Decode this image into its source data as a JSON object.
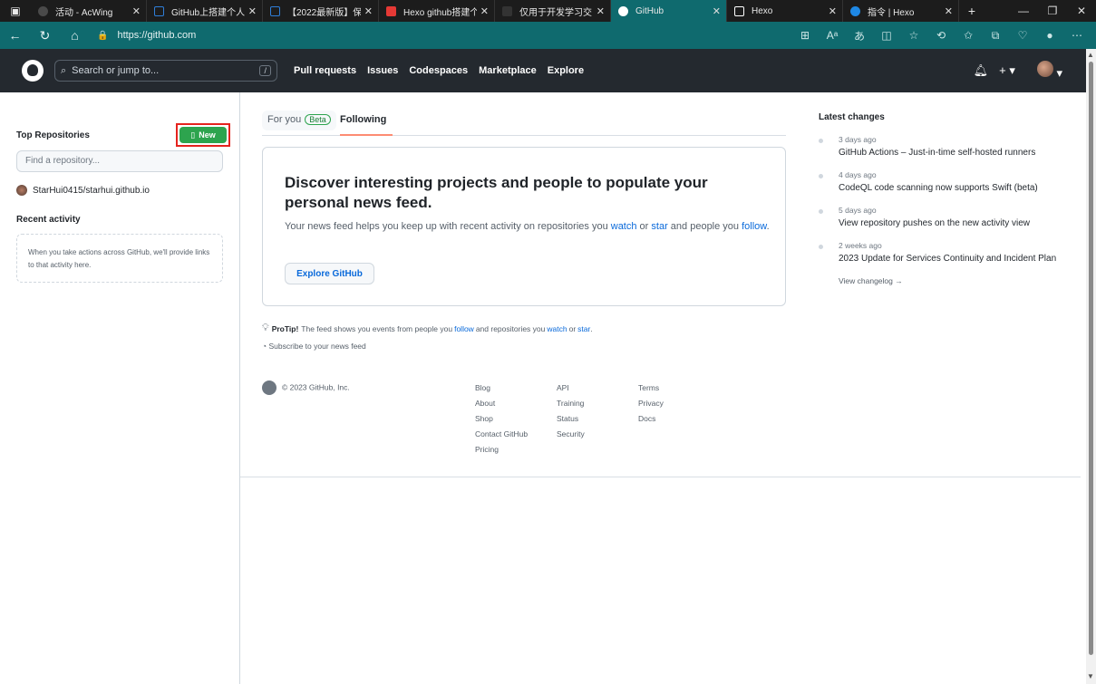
{
  "browser": {
    "tabs": [
      {
        "label": "活动 - AcWing",
        "color": "#4a4a4a"
      },
      {
        "label": "GitHub上搭建个人",
        "color": "#2f7ed8"
      },
      {
        "label": "【2022最新版】保",
        "color": "#2f7ed8"
      },
      {
        "label": "Hexo github搭建个",
        "color": "#e53935"
      },
      {
        "label": "仅用于开发学习交",
        "color": "#333333"
      },
      {
        "label": "GitHub",
        "color": "#ffffff"
      },
      {
        "label": "Hexo",
        "color": "#ffffff"
      },
      {
        "label": "指令 | Hexo",
        "color": "#1e88e5"
      }
    ],
    "new_tab": "+",
    "url": "https://github.com"
  },
  "header": {
    "search_placeholder": "Search or jump to...",
    "search_shortcut": "/",
    "nav": [
      "Pull requests",
      "Issues",
      "Codespaces",
      "Marketplace",
      "Explore"
    ],
    "plus": "+ ▾"
  },
  "left": {
    "top_repos_title": "Top Repositories",
    "new_label": "New",
    "find_placeholder": "Find a repository...",
    "repo": "StarHui0415/starhui.github.io",
    "recent_title": "Recent activity",
    "recent_text": "When you take actions across GitHub, we'll provide links to that activity here."
  },
  "feed": {
    "tab_for_you": "For you",
    "tab_beta": "Beta",
    "tab_following": "Following",
    "card_title": "Discover interesting projects and people to populate your personal news feed.",
    "card_text_1": "Your news feed helps you keep up with recent activity on repositories you ",
    "watch": "watch",
    "card_text_2": " or ",
    "star": "star",
    "card_text_3": " and people you ",
    "follow": "follow",
    "card_text_4": ".",
    "explore_btn": "Explore GitHub",
    "protip_label": "ProTip!",
    "protip_text_1": "The feed shows you events from people you ",
    "protip_follow": "follow",
    "protip_text_2": " and repositories you ",
    "protip_watch": "watch",
    "protip_text_3": " or ",
    "protip_star": "star",
    "protip_text_4": ".",
    "subscribe": "Subscribe to your news feed"
  },
  "footer": {
    "copyright": "© 2023 GitHub, Inc.",
    "col1": [
      "Blog",
      "About",
      "Shop",
      "Contact GitHub",
      "Pricing"
    ],
    "col2": [
      "API",
      "Training",
      "Status",
      "Security"
    ],
    "col3": [
      "Terms",
      "Privacy",
      "Docs"
    ]
  },
  "changes": {
    "title": "Latest changes",
    "items": [
      {
        "date": "3 days ago",
        "text": "GitHub Actions – Just-in-time self-hosted runners"
      },
      {
        "date": "4 days ago",
        "text": "CodeQL code scanning now supports Swift (beta)"
      },
      {
        "date": "5 days ago",
        "text": "View repository pushes on the new activity view"
      },
      {
        "date": "2 weeks ago",
        "text": "2023 Update for Services Continuity and Incident Plan"
      }
    ],
    "view_changelog": "View changelog →"
  }
}
